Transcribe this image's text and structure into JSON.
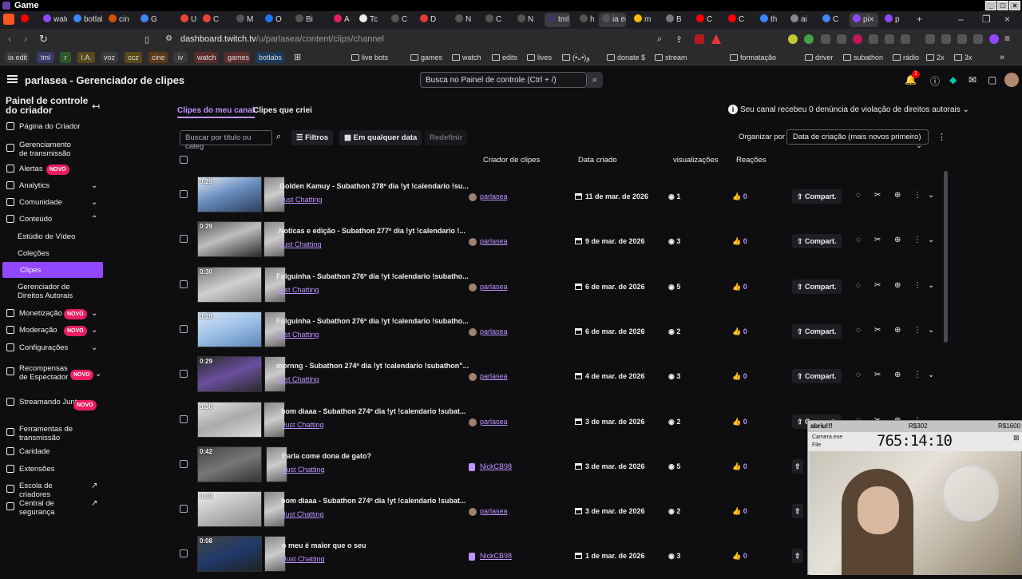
{
  "os": {
    "title": "Game"
  },
  "tabs": [
    {
      "label": "",
      "color": "#ff0000"
    },
    {
      "label": "watch",
      "color": "#9147ff"
    },
    {
      "label": "botlabs",
      "color": "#3a86ff"
    },
    {
      "label": "cine",
      "color": "#d35400"
    },
    {
      "label": "G",
      "color": "#4285f4"
    },
    {
      "label": "U",
      "color": "#ea4335"
    },
    {
      "label": "C",
      "color": "#ea4335"
    },
    {
      "label": "M",
      "color": "#555"
    },
    {
      "label": "O",
      "color": "#1877f2"
    },
    {
      "label": "Bi",
      "color": "#555"
    },
    {
      "label": "A",
      "color": "#e91e63"
    },
    {
      "label": "Tc",
      "color": "#eee"
    },
    {
      "label": "C",
      "color": "#555"
    },
    {
      "label": "D",
      "color": "#e53935"
    },
    {
      "label": "N",
      "color": "#555"
    },
    {
      "label": "C",
      "color": "#555"
    },
    {
      "label": "N",
      "color": "#555"
    },
    {
      "label": "tml",
      "color": "#3a3a6a"
    },
    {
      "label": "h",
      "color": "#555"
    },
    {
      "label": "ia edit",
      "color": "#555"
    },
    {
      "label": "m",
      "color": "#fbbc04"
    },
    {
      "label": "B",
      "color": "#777"
    },
    {
      "label": "C",
      "color": "#ff0000"
    },
    {
      "label": "C",
      "color": "#ff0000"
    },
    {
      "label": "th",
      "color": "#3a86ff"
    },
    {
      "label": "ai",
      "color": "#888"
    },
    {
      "label": "C",
      "color": "#4285f4"
    },
    {
      "label": "pi",
      "color": "#9147ff"
    },
    {
      "label": "p",
      "color": "#9147ff"
    }
  ],
  "address": {
    "host": "dashboard.twitch.tv",
    "path": "/u/parlasea/content/clips/channel"
  },
  "bookmarks": [
    {
      "label": "ia edit",
      "pill": "#3a3a3d"
    },
    {
      "label": "tml",
      "pill": "#3a3a6a"
    },
    {
      "label": "r",
      "pill": "#2d5a2d"
    },
    {
      "label": "I.A.",
      "pill": "#5a4a1a"
    },
    {
      "label": "voz",
      "pill": "#3a3a3d"
    },
    {
      "label": "ccz",
      "pill": "#5a4a1a"
    },
    {
      "label": "cine",
      "pill": "#5a3a1a"
    },
    {
      "label": "iv",
      "pill": "#3a3a3d"
    },
    {
      "label": "watch",
      "pill": "#5a2d2d"
    },
    {
      "label": "games",
      "pill": "#5a2d2d"
    },
    {
      "label": "botlabs",
      "pill": "#1a3a5a"
    }
  ],
  "bookmarks2": [
    "live bots",
    "games",
    "watch",
    "edits",
    "lives",
    "(•̀ᴗ•́)و",
    "donate $",
    "stream",
    "formatação",
    "driver",
    "subathon",
    "rádio",
    "2x",
    "3x"
  ],
  "topnav": {
    "title": "parlasea - Gerenciador de clipes",
    "search_placeholder": "Busca no Painel de controle (Ctrl + /)",
    "notif_count": "1"
  },
  "sidebar": {
    "title": "Painel de controle do criador",
    "items": [
      {
        "label": "Página do Criador",
        "icon": "home-icon"
      },
      {
        "label": "Gerenciamento de transmissão",
        "icon": "broadcast-icon"
      },
      {
        "label": "Alertas",
        "icon": "alert-icon",
        "badge": "NOVO"
      },
      {
        "label": "Analytics",
        "icon": "chart-icon"
      },
      {
        "label": "Comunidade",
        "icon": "community-icon"
      },
      {
        "label": "Conteúdo",
        "icon": "content-icon"
      },
      {
        "label": "Estúdio de Vídeo"
      },
      {
        "label": "Coleções"
      },
      {
        "label": "Clipes"
      },
      {
        "label": "Gerenciador de Direitos Autorais"
      },
      {
        "label": "Monetização",
        "icon": "money-icon",
        "badge": "NOVO"
      },
      {
        "label": "Moderação",
        "icon": "shield-icon",
        "badge": "NOVO"
      },
      {
        "label": "Configurações",
        "icon": "gear-icon"
      },
      {
        "label": "Recompensas de Espectador",
        "icon": "reward-icon",
        "badge": "NOVO"
      },
      {
        "label": "Streamando Juntos",
        "icon": "together-icon",
        "badge": "NOVO"
      },
      {
        "label": "Ferramentas de transmissão",
        "icon": "tools-icon"
      },
      {
        "label": "Caridade",
        "icon": "heart-icon"
      },
      {
        "label": "Extensões",
        "icon": "puzzle-icon"
      },
      {
        "label": "Escola de criadores",
        "icon": "school-icon"
      },
      {
        "label": "Central de segurança",
        "icon": "lock-icon"
      }
    ]
  },
  "content": {
    "tabs": [
      "Clipes do meu canal",
      "Clipes que criei"
    ],
    "notice": "Seu canal recebeu 0 denúncia de violação de direitos autorais",
    "filter_placeholder": "Buscar por título ou categ",
    "filters_label": "Filtros",
    "date_label": "Em qualquer data",
    "reset_label": "Redefinir",
    "org_label": "Organizar por",
    "sort_value": "Data de criação (mais novos primeiro)",
    "headers": {
      "creator": "Criador de clipes",
      "date": "Data criado",
      "views": "visualizações",
      "reactions": "Reações"
    },
    "share_label": "Compart.",
    "clips": [
      {
        "dur": "0:29",
        "title": "Golden Kamuy - Subathon 278º dia !yt !calendario !su...",
        "game": "Just Chatting",
        "creator": "parlasea",
        "date": "11 de mar. de 2026",
        "views": "1",
        "reactions": "0"
      },
      {
        "dur": "0:29",
        "title": "Notícas e edição - Subathon 277º dia !yt !calendario !...",
        "game": "Just Chatting",
        "creator": "parlasea",
        "date": "9 de mar. de 2026",
        "views": "3",
        "reactions": "0"
      },
      {
        "dur": "0:30",
        "title": "Folguinha - Subathon 276º dia !yt !calendario !subatho...",
        "game": "Just Chatting",
        "creator": "parlasea",
        "date": "6 de mar. de 2026",
        "views": "5",
        "reactions": "0"
      },
      {
        "dur": "0:29",
        "title": "Folguinha - Subathon 276º dia !yt !calendario !subatho...",
        "game": "Just Chatting",
        "creator": "parlasea",
        "date": "6 de mar. de 2026",
        "views": "2",
        "reactions": "0"
      },
      {
        "dur": "0:29",
        "title": "mornng - Subathon 274º dia !yt !calendario !subathon\"...",
        "game": "Just Chatting",
        "creator": "parlasea",
        "date": "4 de mar. de 2026",
        "views": "3",
        "reactions": "0"
      },
      {
        "dur": "0:30",
        "title": "bom diaaa - Subathon 274º dia !yt !calendario !subat...",
        "game": "Just Chatting",
        "creator": "parlasea",
        "date": "3 de mar. de 2026",
        "views": "2",
        "reactions": "0"
      },
      {
        "dur": "0:42",
        "title": "Parla come dona de gato?",
        "game": "Just Chatting",
        "creator": "NickCB98",
        "date": "3 de mar. de 2026",
        "views": "5",
        "reactions": "0"
      },
      {
        "dur": "0:30",
        "title": "bom diaaa - Subathon 274º dia !yt !calendario !subat...",
        "game": "Just Chatting",
        "creator": "parlasea",
        "date": "3 de mar. de 2026",
        "views": "2",
        "reactions": "0"
      },
      {
        "dur": "0:08",
        "title": "o meu é maior que o seu",
        "game": "Just Chatting",
        "creator": "NickCB98",
        "date": "1 de mar. de 2026",
        "views": "3",
        "reactions": "0"
      }
    ]
  },
  "cam": {
    "tag": "abriu!!!",
    "r1": "R$302",
    "r2": "R$1600",
    "app": "Camera.exe",
    "menu": "File",
    "timer": "765:14:10"
  }
}
